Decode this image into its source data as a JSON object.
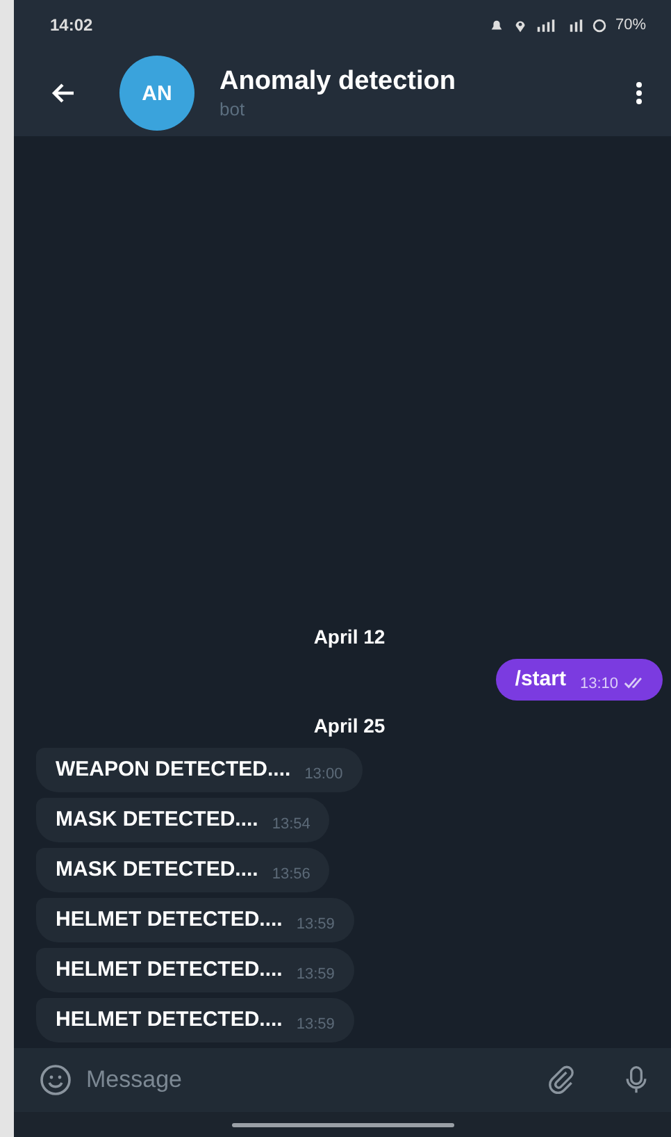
{
  "status_bar": {
    "time": "14:02",
    "battery": "70%"
  },
  "header": {
    "avatar": "AN",
    "title": "Anomaly detection",
    "subtitle": "bot"
  },
  "messages": [
    {
      "kind": "date",
      "text": "April 12"
    },
    {
      "kind": "outgoing",
      "text": "/start",
      "time": "13:10",
      "read": true
    },
    {
      "kind": "date",
      "text": "April 25"
    },
    {
      "kind": "incoming",
      "text": "WEAPON DETECTED....",
      "time": "13:00"
    },
    {
      "kind": "incoming",
      "text": "MASK DETECTED....",
      "time": "13:54"
    },
    {
      "kind": "incoming",
      "text": "MASK DETECTED....",
      "time": "13:56"
    },
    {
      "kind": "incoming",
      "text": "HELMET DETECTED....",
      "time": "13:59"
    },
    {
      "kind": "incoming",
      "text": "HELMET DETECTED....",
      "time": "13:59"
    },
    {
      "kind": "incoming",
      "text": "HELMET DETECTED....",
      "time": "13:59"
    }
  ],
  "composer": {
    "placeholder": "Message"
  }
}
